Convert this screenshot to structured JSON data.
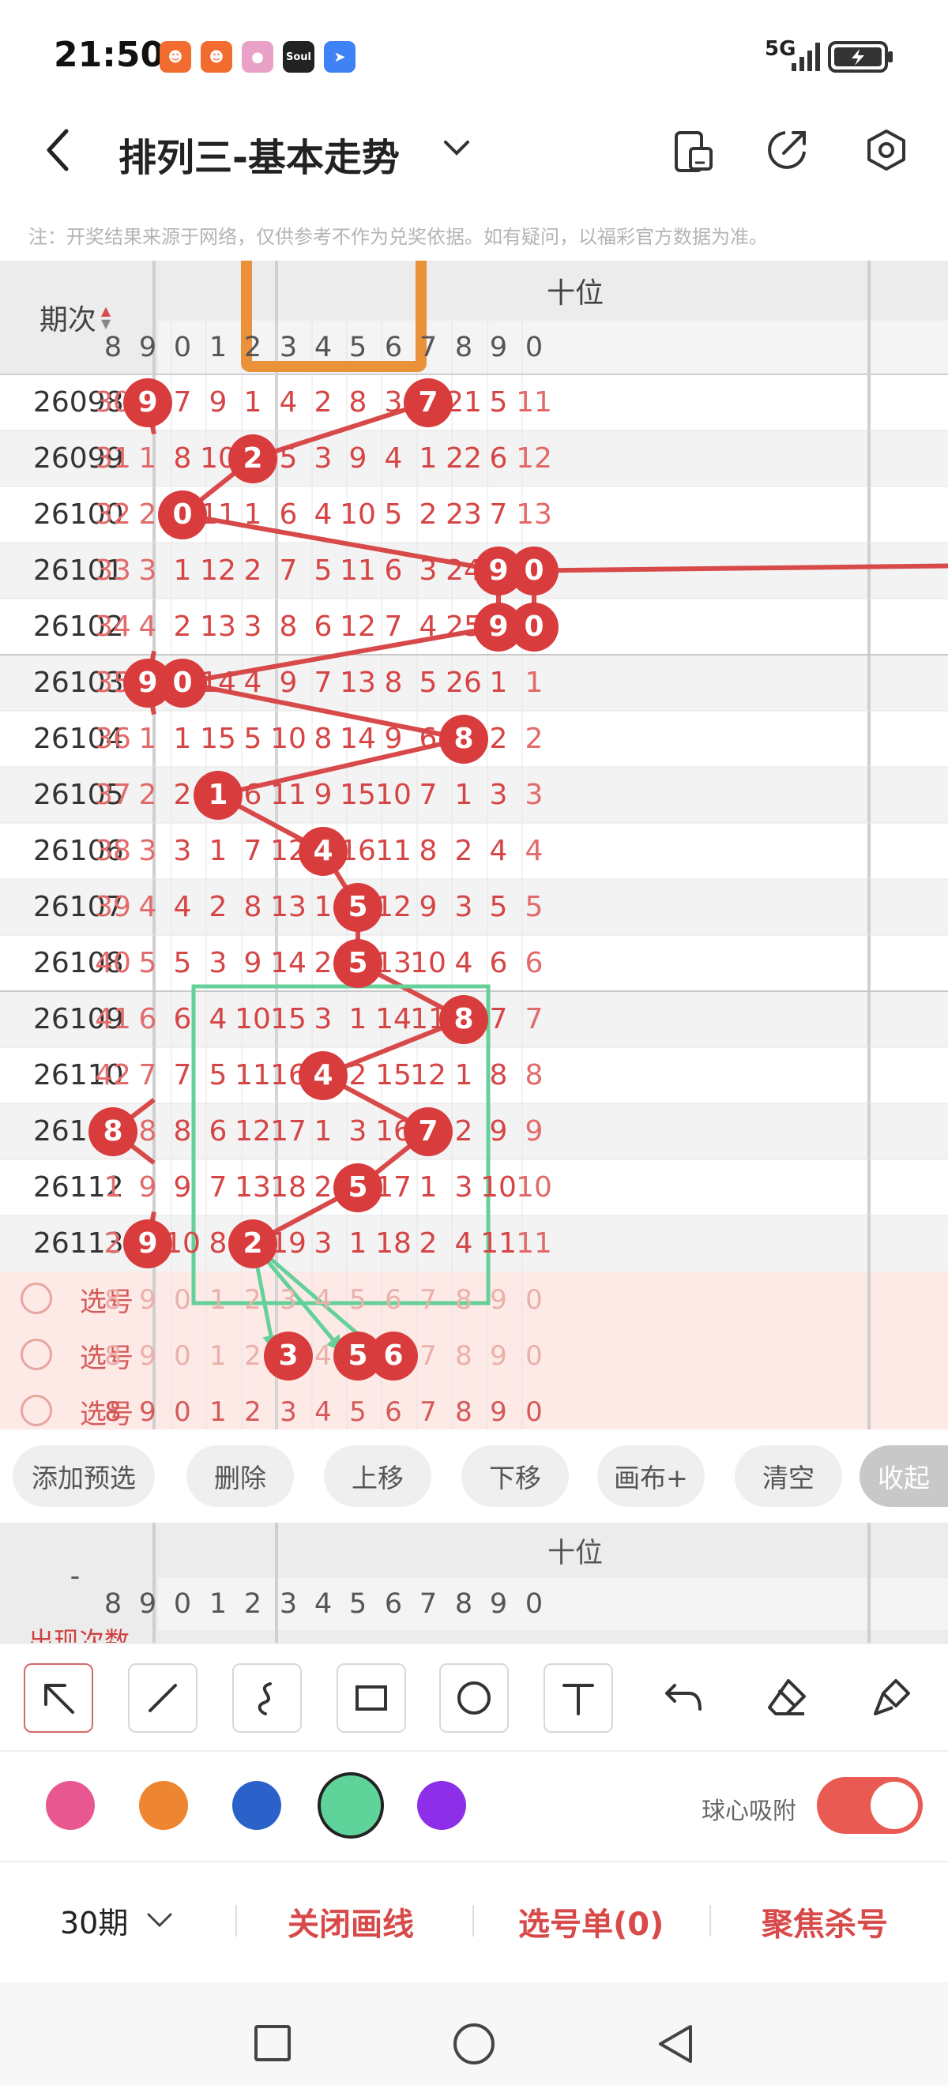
{
  "status_bar": {
    "time": "21:50",
    "app_icons": [
      "app-icon-1",
      "app-icon-2",
      "app-icon-3",
      "soul-app-icon",
      "app-icon-5"
    ],
    "soul_label": "Soul",
    "network": "5G",
    "battery_icon": "battery-charging-icon"
  },
  "header": {
    "title": "排列三-基本走势",
    "icons": [
      "back-icon",
      "chevron-down-icon",
      "phone-icon",
      "share-icon",
      "settings-icon"
    ]
  },
  "notice": "注：开奖结果来源于网络，仅供参考不作为兑奖依据。如有疑问，以福彩官方数据为准。",
  "table": {
    "period_header": "期次",
    "group_header": "十位",
    "columns": [
      "8",
      "9",
      "0",
      "1",
      "2",
      "3",
      "4",
      "5",
      "6",
      "7",
      "8",
      "9",
      "0"
    ],
    "rows": [
      {
        "period": "26098",
        "cells": [
          "30",
          "9",
          "7",
          "9",
          "1",
          "4",
          "2",
          "8",
          "3",
          "7",
          "21",
          "5",
          "11"
        ],
        "hits": [
          1,
          9
        ]
      },
      {
        "period": "26099",
        "cells": [
          "31",
          "1",
          "8",
          "10",
          "2",
          "5",
          "3",
          "9",
          "4",
          "1",
          "22",
          "6",
          "12"
        ],
        "hits": [
          4
        ]
      },
      {
        "period": "26100",
        "cells": [
          "32",
          "2",
          "0",
          "11",
          "1",
          "6",
          "4",
          "10",
          "5",
          "2",
          "23",
          "7",
          "13"
        ],
        "hits": [
          2
        ]
      },
      {
        "period": "26101",
        "cells": [
          "33",
          "3",
          "1",
          "12",
          "2",
          "7",
          "5",
          "11",
          "6",
          "3",
          "24",
          "9",
          "0"
        ],
        "hits": [
          11,
          12
        ]
      },
      {
        "period": "26102",
        "cells": [
          "34",
          "4",
          "2",
          "13",
          "3",
          "8",
          "6",
          "12",
          "7",
          "4",
          "25",
          "9",
          "0"
        ],
        "hits": [
          11,
          12
        ]
      },
      {
        "period": "26103",
        "cells": [
          "35",
          "9",
          "0",
          "14",
          "4",
          "9",
          "7",
          "13",
          "8",
          "5",
          "26",
          "1",
          "1"
        ],
        "hits": [
          1,
          2
        ]
      },
      {
        "period": "26104",
        "cells": [
          "36",
          "1",
          "1",
          "15",
          "5",
          "10",
          "8",
          "14",
          "9",
          "6",
          "8",
          "2",
          "2"
        ],
        "hits": [
          10
        ]
      },
      {
        "period": "26105",
        "cells": [
          "37",
          "2",
          "2",
          "1",
          "6",
          "11",
          "9",
          "15",
          "10",
          "7",
          "1",
          "3",
          "3"
        ],
        "hits": [
          3
        ]
      },
      {
        "period": "26106",
        "cells": [
          "38",
          "3",
          "3",
          "1",
          "7",
          "12",
          "4",
          "16",
          "11",
          "8",
          "2",
          "4",
          "4"
        ],
        "hits": [
          6
        ]
      },
      {
        "period": "26107",
        "cells": [
          "39",
          "4",
          "4",
          "2",
          "8",
          "13",
          "1",
          "5",
          "12",
          "9",
          "3",
          "5",
          "5"
        ],
        "hits": [
          7
        ]
      },
      {
        "period": "26108",
        "cells": [
          "40",
          "5",
          "5",
          "3",
          "9",
          "14",
          "2",
          "5",
          "13",
          "10",
          "4",
          "6",
          "6"
        ],
        "hits": [
          7
        ]
      },
      {
        "period": "26109",
        "cells": [
          "41",
          "6",
          "6",
          "4",
          "10",
          "15",
          "3",
          "1",
          "14",
          "11",
          "8",
          "7",
          "7"
        ],
        "hits": [
          10
        ]
      },
      {
        "period": "26110",
        "cells": [
          "42",
          "7",
          "7",
          "5",
          "11",
          "16",
          "4",
          "2",
          "15",
          "12",
          "1",
          "8",
          "8"
        ],
        "hits": [
          6
        ]
      },
      {
        "period": "26111",
        "cells": [
          "8",
          "8",
          "8",
          "6",
          "12",
          "17",
          "1",
          "3",
          "16",
          "7",
          "2",
          "9",
          "9"
        ],
        "hits": [
          0,
          9
        ]
      },
      {
        "period": "26112",
        "cells": [
          "1",
          "9",
          "9",
          "7",
          "13",
          "18",
          "2",
          "5",
          "17",
          "1",
          "3",
          "10",
          "10"
        ],
        "hits": [
          7
        ]
      },
      {
        "period": "26113",
        "cells": [
          "2",
          "9",
          "10",
          "8",
          "2",
          "19",
          "3",
          "1",
          "18",
          "2",
          "4",
          "11",
          "11"
        ],
        "hits": [
          1,
          4
        ]
      }
    ],
    "pick_rows": [
      {
        "label": "选号",
        "cells": [
          "8",
          "9",
          "0",
          "1",
          "2",
          "3",
          "4",
          "5",
          "6",
          "7",
          "8",
          "9",
          "0"
        ],
        "picked": []
      },
      {
        "label": "选号",
        "cells": [
          "8",
          "9",
          "0",
          "1",
          "2",
          "3",
          "4",
          "5",
          "6",
          "7",
          "8",
          "9",
          "0"
        ],
        "picked": [
          5,
          7,
          8
        ]
      },
      {
        "label": "选号",
        "cells": [
          "8",
          "9",
          "0",
          "1",
          "2",
          "3",
          "4",
          "5",
          "6",
          "7",
          "8",
          "9",
          "0"
        ],
        "picked": []
      }
    ]
  },
  "chips": [
    "添加预选",
    "删除",
    "上移",
    "下移",
    "画布+",
    "清空",
    "收起"
  ],
  "stats": {
    "label": "-",
    "group_header": "十位",
    "columns": [
      "8",
      "9",
      "0",
      "1",
      "2",
      "3",
      "4",
      "5",
      "6",
      "7",
      "8",
      "9",
      "0"
    ],
    "row_label": "出现次数"
  },
  "tools": [
    "arrow-tool-icon",
    "line-tool-icon",
    "curve-tool-icon",
    "rectangle-tool-icon",
    "circle-tool-icon",
    "text-tool-icon",
    "undo-icon",
    "eraser-icon",
    "brush-icon"
  ],
  "colors": {
    "swatches": [
      "#e8578f",
      "#ee8530",
      "#2a62c9",
      "#5ed39a",
      "#8d2fe8"
    ],
    "selected": "#5ed39a",
    "ball": "#d83c3c",
    "highlight_orange": "#e9923a",
    "highlight_green": "#66d09a"
  },
  "snap": {
    "label": "球心吸附",
    "enabled": true
  },
  "bottom_actions": {
    "period_select": "30期",
    "close_lines": "关闭画线",
    "pick_list": "选号单(0)",
    "focus_kill": "聚焦杀号"
  }
}
